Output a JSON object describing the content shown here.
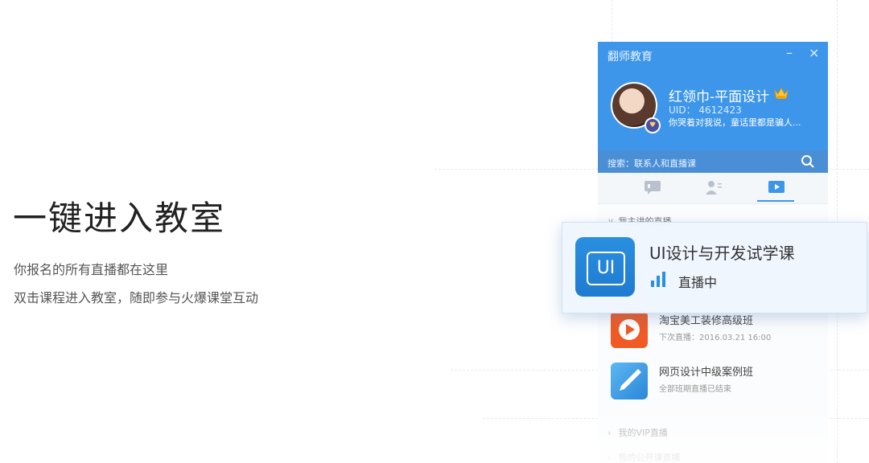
{
  "hero": {
    "title": "一键进入教室",
    "line1": "你报名的所有直播都在这里",
    "line2": "双击课程进入教室，随即参与火爆课堂互动"
  },
  "window": {
    "brand": "翻师教育",
    "minimize_label": "–",
    "close_label": "×"
  },
  "profile": {
    "name": "红领巾-平面设计",
    "uid": "UID： 4612423",
    "motto": "你哭着对我说，童话里都是骗人..."
  },
  "search": {
    "label": "搜索：联系人和直播课",
    "icon": "search-icon"
  },
  "tabs": [
    {
      "name": "chat-tab",
      "icon": "chat-bubble-icon"
    },
    {
      "name": "contacts-tab",
      "icon": "contacts-icon"
    },
    {
      "name": "live-tab",
      "icon": "play-screen-icon",
      "active": true
    }
  ],
  "sections": {
    "main": "我主讲的直播",
    "vip": "我的VIP直播",
    "public": "我的公开课直播"
  },
  "courses": [
    {
      "title": "淘宝美工装修高级班",
      "sub": "下次直播：2016.03.21 16:00",
      "icon": "play-icon",
      "color": "#f05a24"
    },
    {
      "title": "网页设计中级案例班",
      "sub": "全部班期直播已结束",
      "icon": "pen-icon",
      "color": "#3a9be6"
    }
  ],
  "featured": {
    "logo_text": "UI",
    "title": "UI设计与开发试学课",
    "status": "直播中"
  },
  "colors": {
    "accent": "#3d96ea",
    "header": "#3d96ea",
    "search_bar": "#4a8fd6"
  }
}
